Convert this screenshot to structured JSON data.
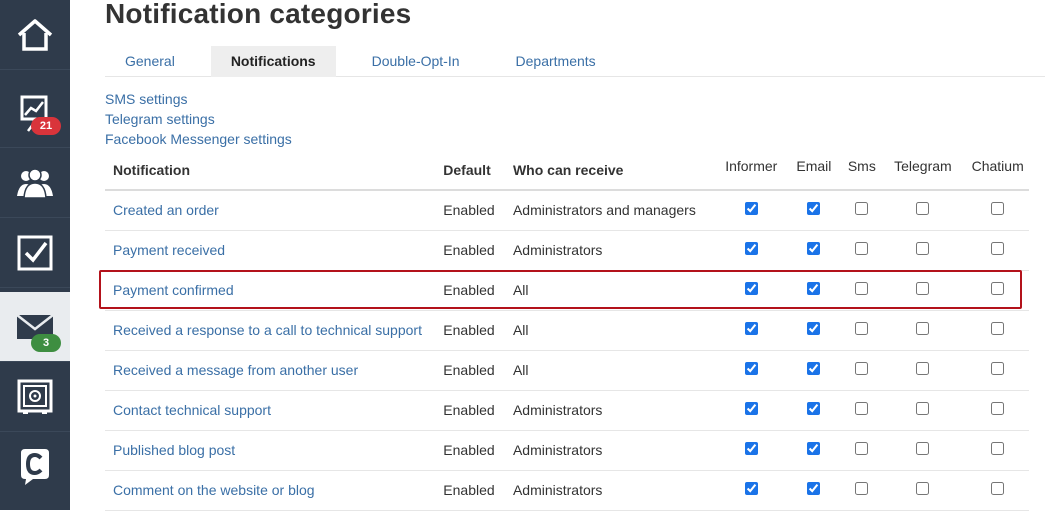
{
  "page_title": "Notification categories",
  "sidebar": {
    "items": [
      {
        "icon": "home-icon"
      },
      {
        "icon": "chart-up-icon",
        "badge": "21",
        "badge_color": "#d9343b"
      },
      {
        "icon": "users-icon"
      },
      {
        "icon": "checkbox-icon"
      },
      {
        "icon": "envelope-icon",
        "badge": "3",
        "badge_color": "#3e8e41"
      },
      {
        "icon": "safe-icon"
      },
      {
        "icon": "chat-c-icon"
      }
    ]
  },
  "tabs": [
    {
      "label": "General"
    },
    {
      "label": "Notifications",
      "active": true
    },
    {
      "label": "Double-Opt-In"
    },
    {
      "label": "Departments"
    }
  ],
  "settings_links": [
    "SMS settings",
    "Telegram settings",
    "Facebook Messenger settings"
  ],
  "table": {
    "headers": {
      "notification": "Notification",
      "default": "Default",
      "who": "Who can receive",
      "informer": "Informer",
      "email": "Email",
      "sms": "Sms",
      "telegram": "Telegram",
      "chatium": "Chatium"
    },
    "rows": [
      {
        "name": "Created an order",
        "default": "Enabled",
        "who": "Administrators and managers",
        "informer": true,
        "email": true,
        "sms": false,
        "telegram": false,
        "chatium": false
      },
      {
        "name": "Payment received",
        "default": "Enabled",
        "who": "Administrators",
        "informer": true,
        "email": true,
        "sms": false,
        "telegram": false,
        "chatium": false
      },
      {
        "name": "Payment confirmed",
        "default": "Enabled",
        "who": "All",
        "informer": true,
        "email": true,
        "sms": false,
        "telegram": false,
        "chatium": false
      },
      {
        "name": "Received a response to a call to technical support",
        "default": "Enabled",
        "who": "All",
        "informer": true,
        "email": true,
        "sms": false,
        "telegram": false,
        "chatium": false
      },
      {
        "name": "Received a message from another user",
        "default": "Enabled",
        "who": "All",
        "informer": true,
        "email": true,
        "sms": false,
        "telegram": false,
        "chatium": false
      },
      {
        "name": "Contact technical support",
        "default": "Enabled",
        "who": "Administrators",
        "informer": true,
        "email": true,
        "sms": false,
        "telegram": false,
        "chatium": false
      },
      {
        "name": "Published blog post",
        "default": "Enabled",
        "who": "Administrators",
        "informer": true,
        "email": true,
        "sms": false,
        "telegram": false,
        "chatium": false
      },
      {
        "name": "Comment on the website or blog",
        "default": "Enabled",
        "who": "Administrators",
        "informer": true,
        "email": true,
        "sms": false,
        "telegram": false,
        "chatium": false
      }
    ]
  },
  "colors": {
    "sidebar_bg": "#2f3b4b",
    "link": "#3a6fa6",
    "highlight_border": "#b3121b"
  }
}
